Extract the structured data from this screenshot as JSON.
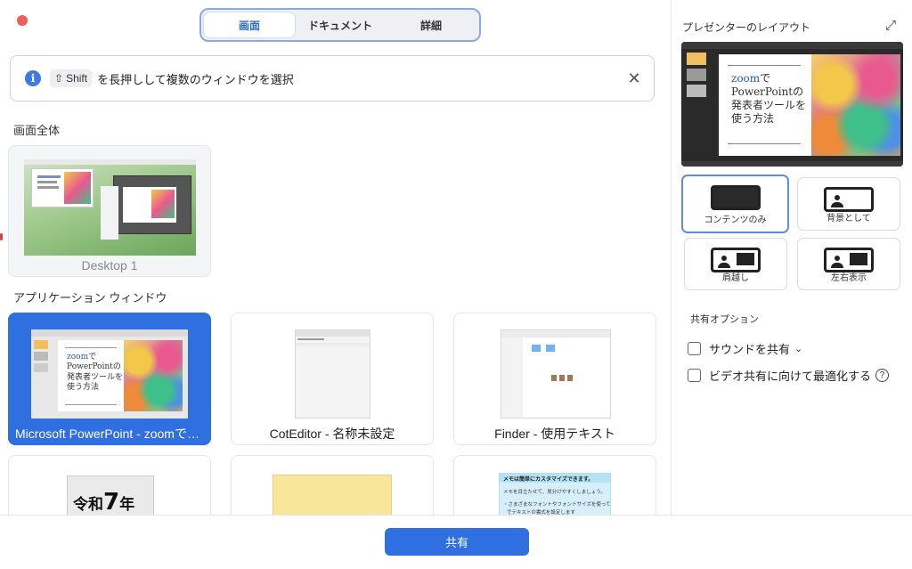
{
  "tabs": [
    {
      "label": "画面",
      "active": true
    },
    {
      "label": "ドキュメント",
      "active": false
    },
    {
      "label": "詳細",
      "active": false
    }
  ],
  "banner": {
    "icon": "info-icon",
    "key_label": "Shift",
    "key_symbol": "⇧",
    "text": "を長押しして複数のウィンドウを選択"
  },
  "sections": {
    "full_screen": "画面全体",
    "app_windows": "アプリケーション ウィンドウ"
  },
  "desktop": {
    "caption": "Desktop 1"
  },
  "windows": [
    {
      "caption": "Microsoft PowerPoint - zoomで…",
      "selected": true
    },
    {
      "caption": "CotEditor - 名称未設定",
      "selected": false
    },
    {
      "caption": "Finder - 使用テキスト",
      "selected": false
    }
  ],
  "partial_tiles": {
    "reiwa_text": "令和",
    "reiwa_num": "7",
    "reiwa_suffix": "年",
    "memo_line1": "メモは簡単にカスタマイズできます。",
    "memo_line2": "メモを目立たせて、見分けやすくしましょう。",
    "memo_line3": "・さまざまなフォントやフォントサイズを使って",
    "memo_line4": "でテキストの書式を設定します"
  },
  "slide_text": {
    "zoom": "zoom",
    "line1_suffix": "で",
    "line2": "PowerPointの",
    "line3": "発表者ツールを",
    "line4": "使う方法"
  },
  "share_button": "共有",
  "right_panel": {
    "title": "プレゼンターのレイアウト",
    "layouts": [
      {
        "label": "コンテンツのみ",
        "active": true
      },
      {
        "label": "背景として",
        "active": false
      },
      {
        "label": "肩越し",
        "active": false
      },
      {
        "label": "左右表示",
        "active": false
      }
    ],
    "options_title": "共有オプション",
    "options": [
      {
        "label": "サウンドを共有",
        "checked": false
      },
      {
        "label": "ビデオ共有に向けて最適化する",
        "checked": false
      }
    ]
  },
  "colors": {
    "accent": "#2f6fe0",
    "close_dot": "#ed5f57"
  }
}
